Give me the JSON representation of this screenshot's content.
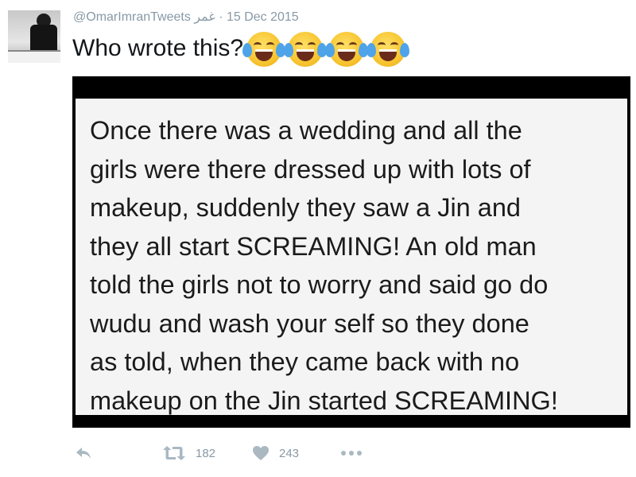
{
  "tweet": {
    "handle": "@OmarImranTweets",
    "display_name": "غمر",
    "separator": "·",
    "date": "15 Dec 2015",
    "text": "Who wrote this?",
    "emojis": [
      "face-with-tears-of-joy",
      "face-with-tears-of-joy",
      "face-with-tears-of-joy",
      "face-with-tears-of-joy"
    ],
    "image_text": "Once there was a wedding and all the\ngirls were there dressed up with lots of\nmakeup, suddenly they saw a Jin and\nthey all start SCREAMING! An old man\ntold the girls not to worry and said go do\nwudu and wash your self so they done\nas told, when they came back with no\nmakeup on the Jin started SCREAMING!"
  },
  "actions": {
    "reply_icon": "reply-icon",
    "retweet_icon": "retweet-icon",
    "retweet_count": "182",
    "like_icon": "heart-icon",
    "like_count": "243",
    "more_icon": "more-icon"
  },
  "colors": {
    "meta": "#8899a6",
    "text": "#14171a",
    "icon": "#aab8c2",
    "card_border": "#000000",
    "card_bg": "#f4f4f4"
  }
}
